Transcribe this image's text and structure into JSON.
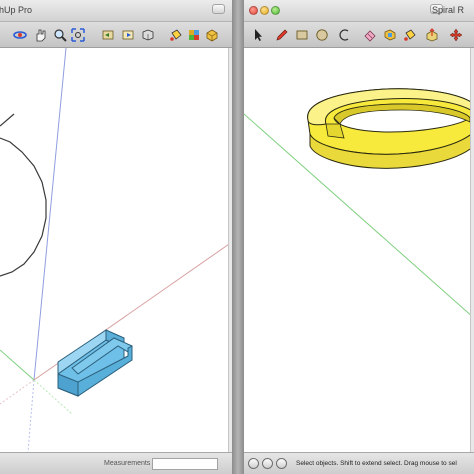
{
  "left_window": {
    "title": "tchUp Pro",
    "measurements_label": "Measurements",
    "measurements_value": ""
  },
  "right_window": {
    "title": "Spiral R",
    "status_text": "Select objects. Shift to extend select. Drag mouse to sel"
  },
  "colors": {
    "axis_red": "#d9a0a0",
    "axis_green": "#7fd07f",
    "axis_blue": "#8f9ee0",
    "selected_solid": "#6fc0e8",
    "ring_solid": "#f7ea3c",
    "window_chrome": "#d2d2d2"
  },
  "left_toolbar_icons": [
    "orbit-icon",
    "pan-icon",
    "zoom-icon",
    "zoom-extents-icon",
    "previous-view-icon",
    "next-view-icon",
    "standard-views-icon",
    "paint-bucket-icon",
    "materials-icon",
    "components-icon"
  ],
  "right_toolbar_icons": [
    "select-arrow-icon",
    "pencil-icon",
    "rectangle-icon",
    "circle-icon",
    "arc-icon",
    "eraser-icon",
    "tape-measure-icon",
    "paint-bucket-icon",
    "push-pull-icon",
    "move-icon"
  ]
}
